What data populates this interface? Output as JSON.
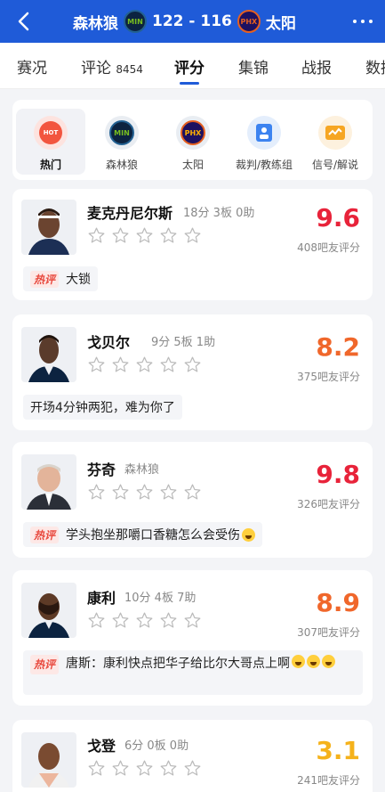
{
  "header": {
    "home_team": "森林狼",
    "home_logo_text": "MIN",
    "score": "122 - 116",
    "away_logo_text": "PHX",
    "away_team": "太阳"
  },
  "tabs": [
    {
      "label": "赛况"
    },
    {
      "label": "评论",
      "count": "8454"
    },
    {
      "label": "评分"
    },
    {
      "label": "集锦"
    },
    {
      "label": "战报"
    },
    {
      "label": "数据"
    }
  ],
  "filters": [
    {
      "label": "热门",
      "icon_text": "HOT"
    },
    {
      "label": "森林狼",
      "icon_text": "MIN"
    },
    {
      "label": "太阳",
      "icon_text": "PHX"
    },
    {
      "label": "裁判/教练组"
    },
    {
      "label": "信号/解说"
    }
  ],
  "cards": [
    {
      "name": "麦克丹尼尔斯",
      "stats": "18分 3板 0助",
      "score": "9.6",
      "votes": "408吧友评分",
      "hot": "热评",
      "comment": "大锁",
      "score_color": "#e8233a"
    },
    {
      "name": "戈贝尔",
      "stats": "9分 5板 1助",
      "score": "8.2",
      "votes": "375吧友评分",
      "hot": "",
      "comment": "开场4分钟两犯，难为你了",
      "score_color": "#f0672b"
    },
    {
      "name": "芬奇",
      "stats": "森林狼",
      "score": "9.8",
      "votes": "326吧友评分",
      "hot": "热评",
      "comment": "学头抱坐那嚼口香糖怎么会受伤",
      "score_color": "#e8233a"
    },
    {
      "name": "康利",
      "stats": "10分 4板 7助",
      "score": "8.9",
      "votes": "307吧友评分",
      "hot": "热评",
      "comment": "唐斯：康利快点把华子给比尔大哥点上啊",
      "score_color": "#f0672b"
    },
    {
      "name": "戈登",
      "stats": "6分 0板 0助",
      "score": "3.1",
      "votes": "241吧友评分",
      "hot": "",
      "comment": "",
      "score_color": "#f5b21b"
    }
  ]
}
